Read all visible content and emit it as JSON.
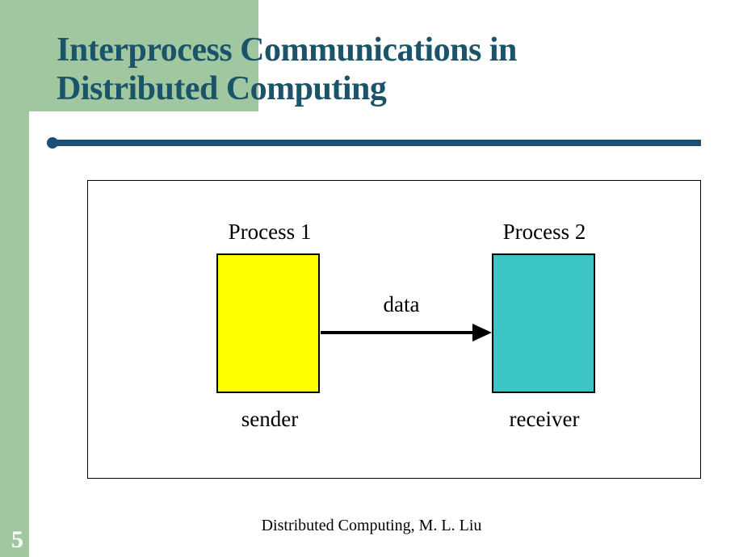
{
  "title_line1": "Interprocess Communications in",
  "title_line2": "Distributed Computing",
  "diagram": {
    "process1_title": "Process 1",
    "process2_title": "Process 2",
    "arrow_label": "data",
    "process1_caption": "sender",
    "process2_caption": "receiver"
  },
  "footer": "Distributed Computing, M. L. Liu",
  "page_number": "5",
  "colors": {
    "accent_green": "#a1c7a1",
    "title_teal": "#1b5468",
    "rule_navy": "#1f4e75",
    "box1_fill": "#ffff00",
    "box2_fill": "#3bc4c4"
  }
}
